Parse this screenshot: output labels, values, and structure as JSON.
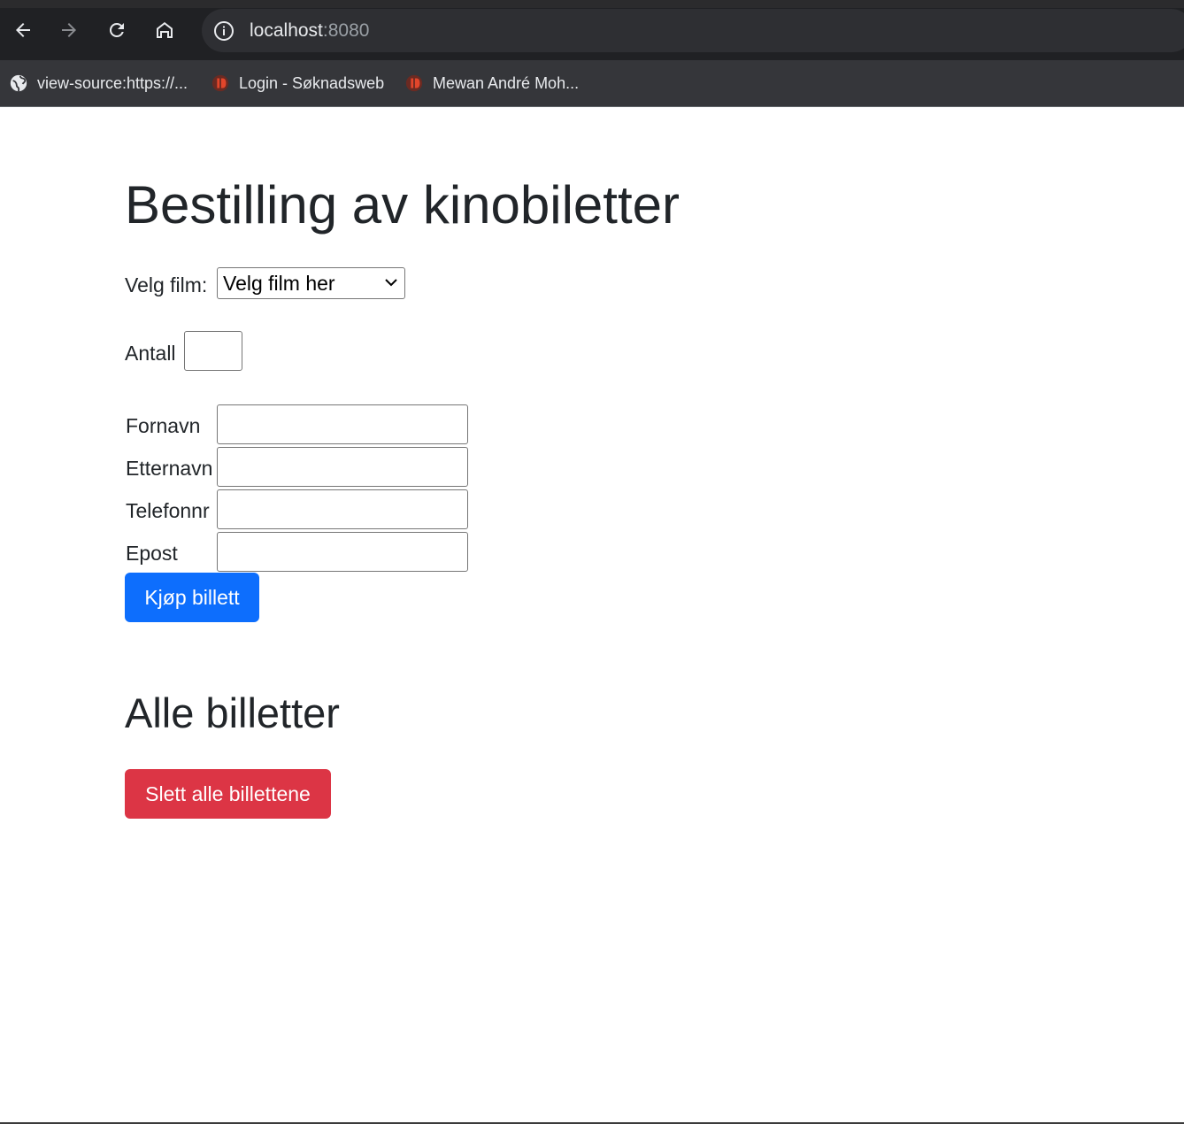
{
  "browser": {
    "url_host": "localhost",
    "url_port": ":8080",
    "bookmarks": [
      {
        "label": "view-source:https://...",
        "icon": "globe-icon"
      },
      {
        "label": "Login - Søknadsweb",
        "icon": "site-logo-icon"
      },
      {
        "label": "Mewan André Moh...",
        "icon": "site-logo-icon"
      }
    ]
  },
  "page": {
    "title": "Bestilling av kinobiletter",
    "film_label": "Velg film:",
    "film_select_value": "Velg film her",
    "antall_label": "Antall",
    "fornavn_label": "Fornavn",
    "etternavn_label": "Etternavn",
    "telefonnr_label": "Telefonnr",
    "epost_label": "Epost",
    "buy_button": "Kjøp billett",
    "all_tickets_title": "Alle billetter",
    "delete_button": "Slett alle billettene"
  },
  "colors": {
    "primary": "#0d6efd",
    "danger": "#dc3545",
    "chrome_dark": "#202124"
  }
}
